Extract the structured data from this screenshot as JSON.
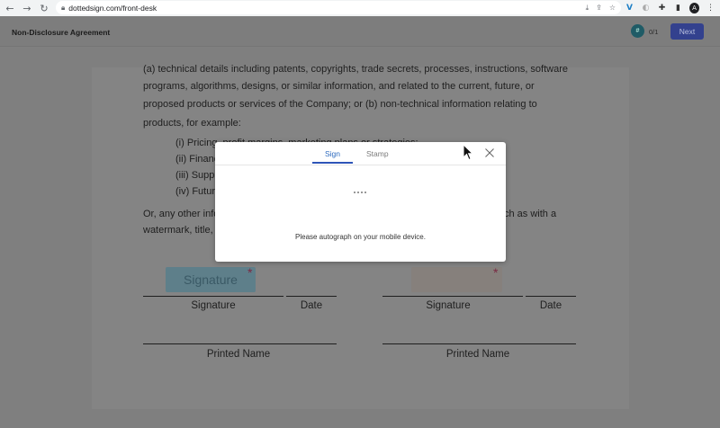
{
  "browser": {
    "back": "←",
    "forward": "→",
    "reload": "↻",
    "url": "dottedsign.com/front-desk",
    "avatar_initial": "A"
  },
  "header": {
    "title": "Non-Disclosure Agreement",
    "progress_icon": "#",
    "progress_count": "0/1",
    "next_label": "Next"
  },
  "document": {
    "lines": [
      "(a) technical details including patents, copyrights, trade secrets, processes, instructions, software",
      "programs, algorithms, designs, or similar information, and related to the current, future, or",
      "proposed products or services of the Company; or (b) non-technical information relating to",
      "products, for example:"
    ],
    "list_items": [
      "(i) Pricing, profit margins, marketing plans or strategies;",
      "(ii) Financ",
      "(iii) Supp",
      "(iv) Futur"
    ],
    "after_lines": [
      "Or, any other info",
      "watermark, title,"
    ],
    "after_line_tail": "ch as with a"
  },
  "signature_block": {
    "left_field_label": "Signature",
    "required_mark": "*",
    "left_signature_label": "Signature",
    "left_date_label": "Date",
    "left_printed_name_label": "Printed Name",
    "right_signature_label": "Signature",
    "right_date_label": "Date",
    "right_printed_name_label": "Printed Name"
  },
  "modal": {
    "tabs": [
      "Sign",
      "Stamp"
    ],
    "active_tab": "Sign",
    "message": "Please autograph on your mobile device."
  },
  "colors": {
    "accent": "#2e55b8",
    "next_button": "#33418e",
    "signature_field": "#5e7f8a",
    "required": "#c2185b"
  }
}
